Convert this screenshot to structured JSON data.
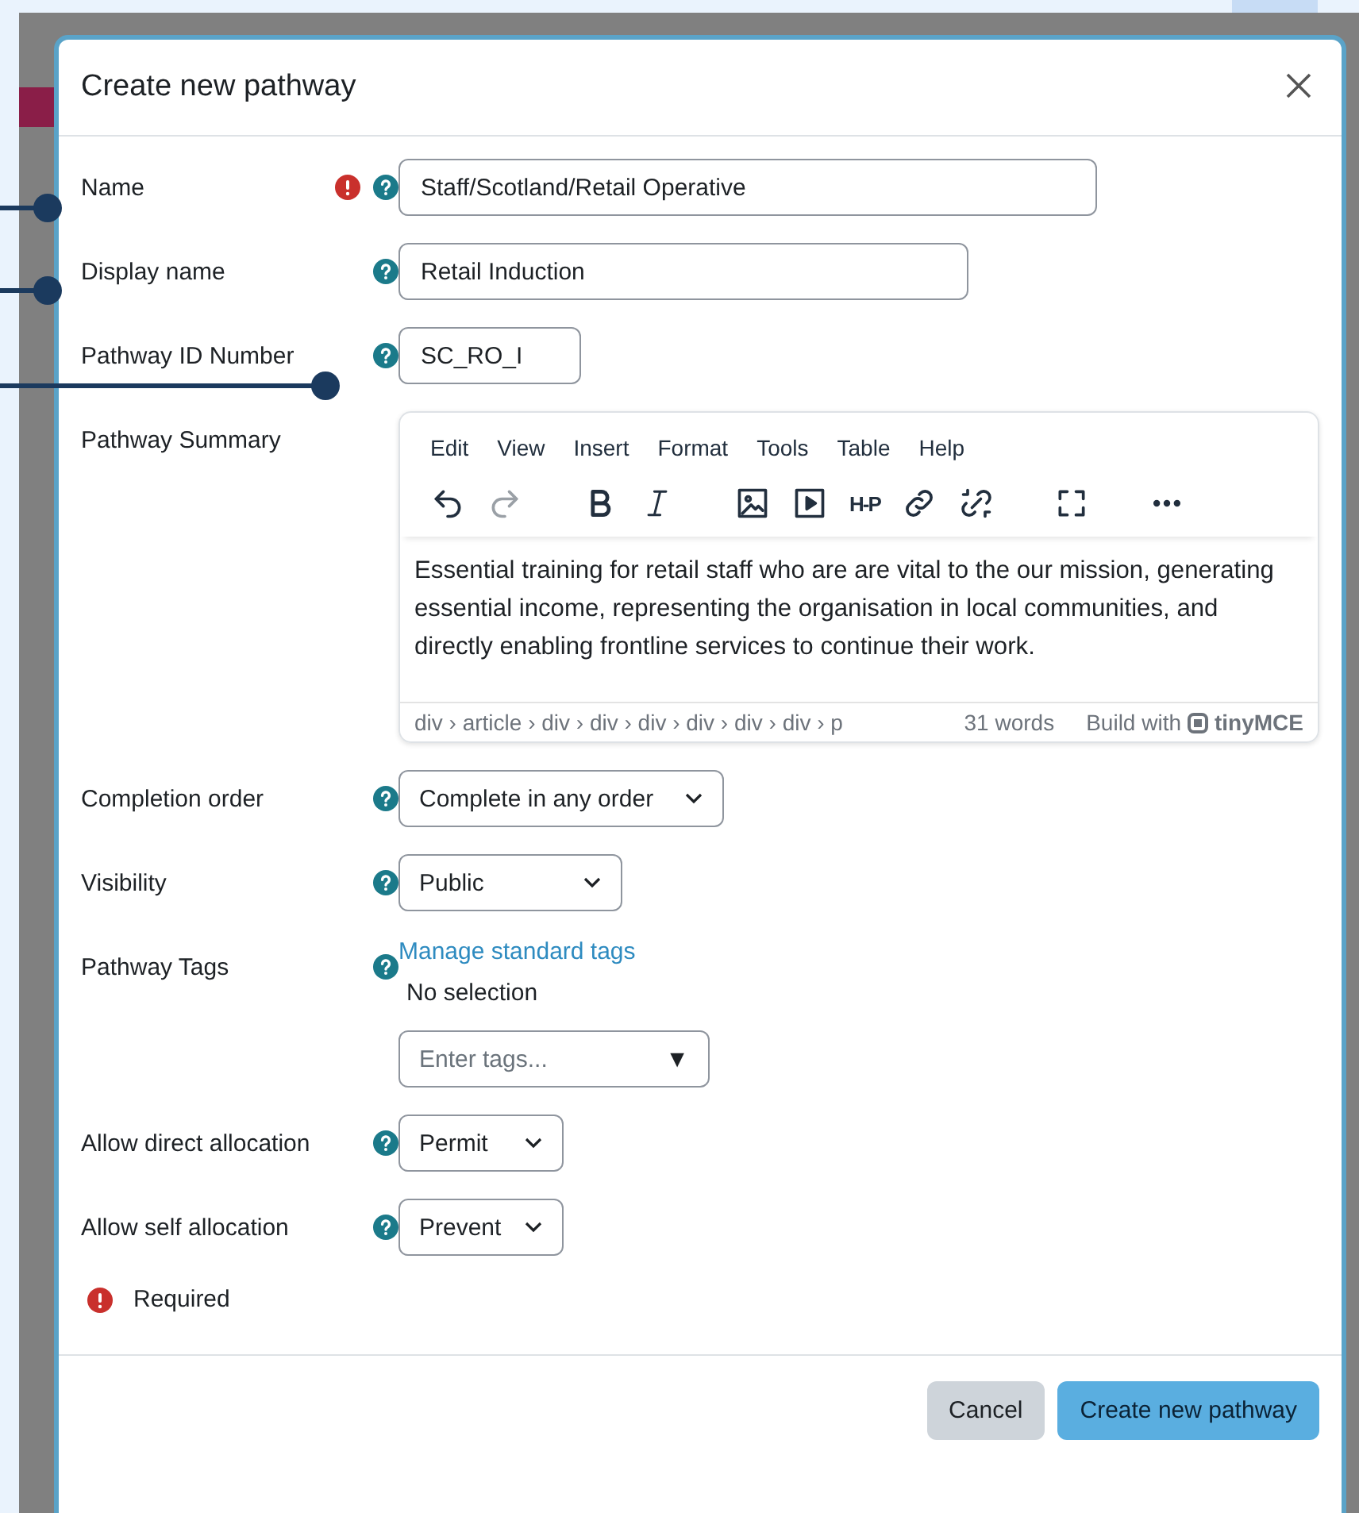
{
  "dialog": {
    "title": "Create new pathway"
  },
  "fields": [
    {
      "kind": "text",
      "label": "Name",
      "required": true,
      "value": "Staff/Scotland/Retail Operative"
    },
    {
      "kind": "text",
      "label": "Display name",
      "required": false,
      "value": "Retail Induction"
    },
    {
      "kind": "text",
      "label": "Pathway ID Number",
      "required": false,
      "value": "SC_RO_I"
    },
    {
      "kind": "editor",
      "label": "Pathway Summary",
      "required": false,
      "menu": [
        "Edit",
        "View",
        "Insert",
        "Format",
        "Tools",
        "Table",
        "Help"
      ],
      "toolbar": [
        {
          "kind": "undo",
          "disabled": false
        },
        {
          "kind": "redo",
          "disabled": true
        },
        {
          "kind": "bold",
          "disabled": false
        },
        {
          "kind": "italic",
          "disabled": false
        },
        {
          "kind": "image",
          "disabled": false
        },
        {
          "kind": "media",
          "disabled": false
        },
        {
          "kind": "h5p",
          "label": "H-P",
          "disabled": false
        },
        {
          "kind": "link",
          "disabled": false
        },
        {
          "kind": "unlink",
          "disabled": false
        },
        {
          "kind": "fullscreen",
          "disabled": false
        },
        {
          "kind": "more",
          "disabled": false
        }
      ],
      "text": "Essential training for retail staff who are are vital to the our mission, generating essential income, representing the organisation in local communities, and directly enabling frontline services to continue their work.",
      "path": "div › article › div › div › div › div › div › div › p",
      "word_count": "31 words",
      "brand_prefix": "Build with",
      "brand": "tinyMCE"
    },
    {
      "kind": "select",
      "label": "Completion order",
      "required": false,
      "value": "Complete in any order"
    },
    {
      "kind": "select",
      "label": "Visibility",
      "required": false,
      "value": "Public"
    },
    {
      "kind": "tags",
      "label": "Pathway Tags",
      "required": false,
      "link": "Manage standard tags",
      "selection": "No selection",
      "placeholder": "Enter tags...",
      "arrow": "▼"
    },
    {
      "kind": "select",
      "label": "Allow direct allocation",
      "required": false,
      "value": "Permit"
    },
    {
      "kind": "select",
      "label": "Allow self allocation",
      "required": false,
      "value": "Prevent"
    }
  ],
  "required_note": "Required",
  "buttons": [
    {
      "kind": "secondary",
      "label": "Cancel"
    },
    {
      "kind": "primary",
      "label": "Create new pathway"
    }
  ]
}
